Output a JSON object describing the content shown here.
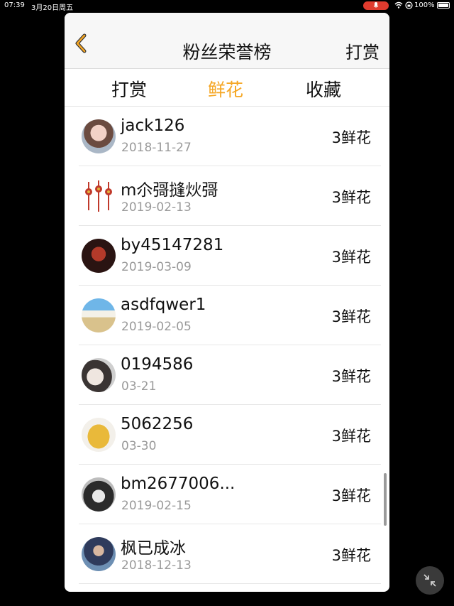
{
  "status_bar": {
    "time": "07:39",
    "date": "3月20日周五",
    "battery": "100%",
    "mic_color": "#e03b2e",
    "icons": [
      "mic-icon",
      "wifi-icon",
      "rotation-lock-icon",
      "battery-icon"
    ]
  },
  "nav": {
    "back_icon": "chevron-left-icon",
    "back_color": "#f5a623",
    "title": "粉丝荣誉榜",
    "right_action": "打赏"
  },
  "tabs": [
    {
      "label": "打赏",
      "active": false
    },
    {
      "label": "鲜花",
      "active": true
    },
    {
      "label": "收藏",
      "active": false
    }
  ],
  "accent_color": "#f5a623",
  "fans": [
    {
      "name": "jack126",
      "date": "2018-11-27",
      "gift": "3鲜花"
    },
    {
      "name": "m尒彁摓炏彁",
      "date": "2019-02-13",
      "gift": "3鲜花"
    },
    {
      "name": "by45147281",
      "date": "2019-03-09",
      "gift": "3鲜花"
    },
    {
      "name": "asdfqwer1",
      "date": "2019-02-05",
      "gift": "3鲜花"
    },
    {
      "name": "0194586",
      "date": "03-21",
      "gift": "3鲜花"
    },
    {
      "name": "5062256",
      "date": "03-30",
      "gift": "3鲜花"
    },
    {
      "name": "bm2677006...",
      "date": "2019-02-15",
      "gift": "3鲜花"
    },
    {
      "name": "枫已成冰",
      "date": "2018-12-13",
      "gift": "3鲜花"
    }
  ],
  "floating_button_icon": "collapse-icon"
}
